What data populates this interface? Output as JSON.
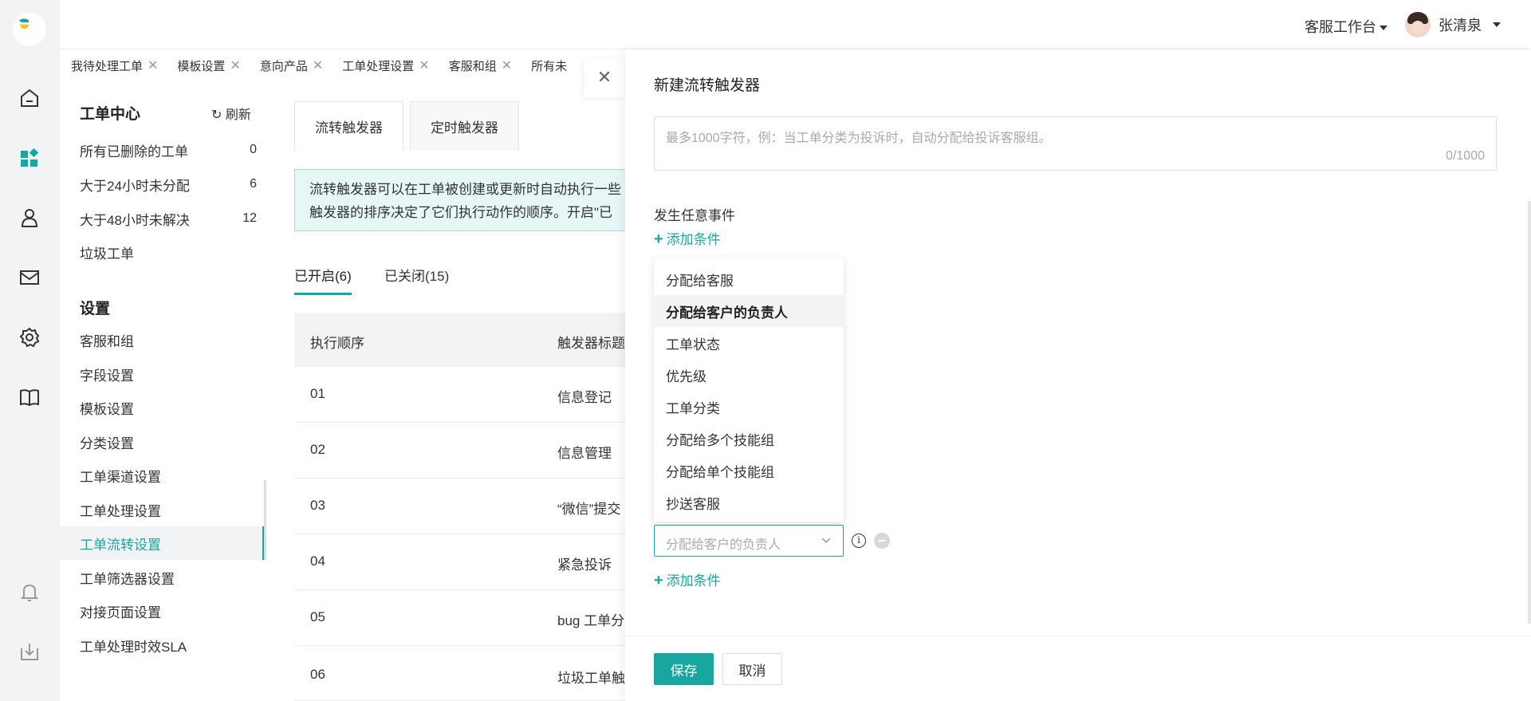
{
  "header": {
    "workbench_label": "客服工作台",
    "user_name": "张清泉"
  },
  "rail": {
    "icons": [
      "logo-icon",
      "home-icon",
      "apps-icon",
      "contacts-icon",
      "mail-icon",
      "settings-icon",
      "book-icon",
      "bell-icon",
      "download-icon"
    ]
  },
  "tabs": [
    {
      "label": "我待处理工单"
    },
    {
      "label": "模板设置"
    },
    {
      "label": "意向产品"
    },
    {
      "label": "工单处理设置"
    },
    {
      "label": "客服和组"
    },
    {
      "label": "所有未"
    }
  ],
  "sidebar": {
    "title": "工单中心",
    "refresh_label": "刷新",
    "views": [
      {
        "label": "所有已删除的工单",
        "count": "0"
      },
      {
        "label": "大于24小时未分配",
        "count": "6"
      },
      {
        "label": "大于48小时未解决",
        "count": "12"
      },
      {
        "label": "垃圾工单",
        "count": ""
      }
    ],
    "settings_title": "设置",
    "settings": [
      {
        "label": "客服和组"
      },
      {
        "label": "字段设置"
      },
      {
        "label": "模板设置"
      },
      {
        "label": "分类设置"
      },
      {
        "label": "工单渠道设置"
      },
      {
        "label": "工单处理设置"
      },
      {
        "label": "工单流转设置"
      },
      {
        "label": "工单筛选器设置"
      },
      {
        "label": "对接页面设置"
      },
      {
        "label": "工单处理时效SLA"
      }
    ]
  },
  "main": {
    "top_tabs": [
      "流转触发器",
      "定时触发器"
    ],
    "notice_line1": "流转触发器可以在工单被创建或更新时自动执行一些",
    "notice_line2": "触发器的排序决定了它们执行动作的顺序。开启\"已",
    "sub_tabs": [
      "已开启(6)",
      "已关闭(15)"
    ],
    "columns": [
      "执行顺序",
      "触发器标题"
    ],
    "rows": [
      {
        "order": "01",
        "title": "信息登记"
      },
      {
        "order": "02",
        "title": "信息管理"
      },
      {
        "order": "03",
        "title": "“微信”提交"
      },
      {
        "order": "04",
        "title": "紧急投诉"
      },
      {
        "order": "05",
        "title": "bug 工单分"
      },
      {
        "order": "06",
        "title": "垃圾工单触"
      }
    ]
  },
  "drawer": {
    "title": "新建流转触发器",
    "desc_placeholder": "最多1000字符，例：当工单分类为投诉时，自动分配给投诉客服组。",
    "desc_counter": "0/1000",
    "event_label": "发生任意事件",
    "add_condition": "添加条件",
    "dropdown_options": [
      "分配给客服",
      "分配给客户的负责人",
      "工单状态",
      "优先级",
      "工单分类",
      "分配给多个技能组",
      "分配给单个技能组",
      "抄送客服"
    ],
    "dropdown_selected_index": 1,
    "select_value": "分配给客户的负责人",
    "save_label": "保存",
    "cancel_label": "取消"
  },
  "colors": {
    "accent": "#18a7a0",
    "notice_bg": "#e6f7f6"
  }
}
